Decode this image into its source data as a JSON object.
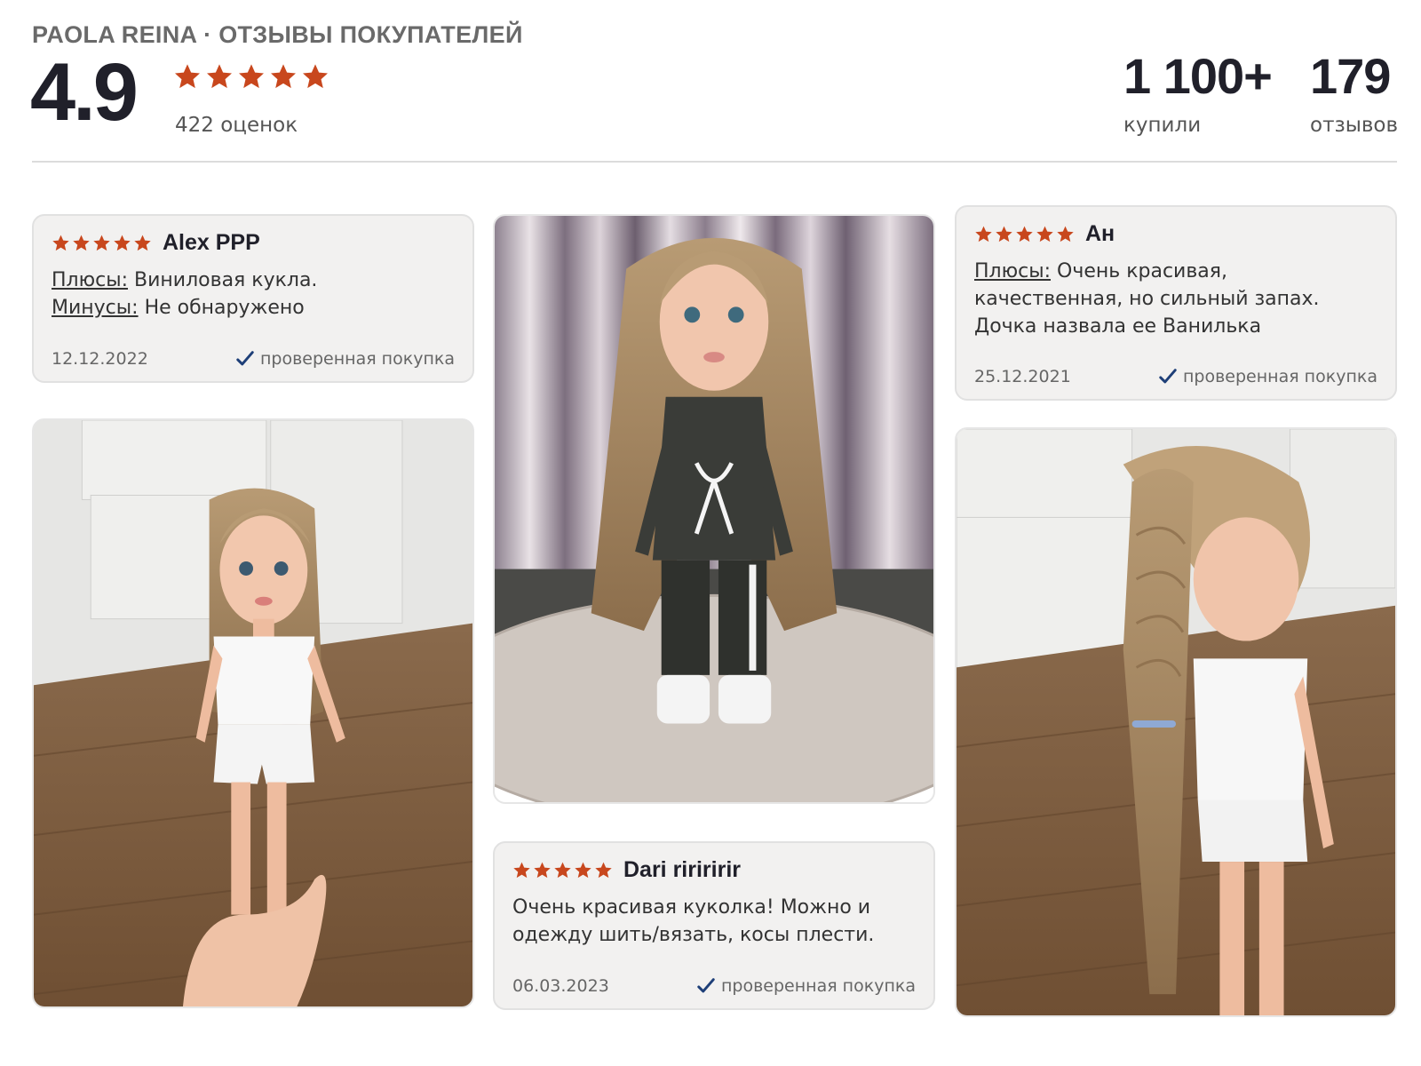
{
  "header": {
    "brand_title": "PAOLA REINA · ОТЗЫВЫ ПОКУПАТЕЛЕЙ",
    "rating": "4.9",
    "stars": 5,
    "ratings_count": "422 оценок",
    "bought_value": "1 100+",
    "bought_label": "купили",
    "reviews_value": "179",
    "reviews_label": "отзывов"
  },
  "colors": {
    "star": "#c8471d",
    "check": "#1e3f78",
    "card_bg": "#f2f1f0"
  },
  "reviews": [
    {
      "author": "Alex PPP",
      "stars": 5,
      "pros_label": "Плюсы:",
      "pros": "Виниловая кукла.",
      "cons_label": "Минусы:",
      "cons": "Не обнаружено",
      "date": "12.12.2022",
      "verified": "проверенная покупка"
    },
    {
      "author": "Dari ririririr",
      "stars": 5,
      "text_line1": "Очень красивая куколка! Можно и",
      "text_line2": "одежду шить/вязать, косы плести.",
      "date": "06.03.2023",
      "verified": "проверенная покупка"
    },
    {
      "author": "Ан",
      "stars": 5,
      "pros_label": "Плюсы:",
      "pros_line1": "Очень красивая,",
      "pros_line2": "качественная, но сильный запах.",
      "pros_line3": "Дочка назвала ее Ванилька",
      "date": "25.12.2021",
      "verified": "проверенная покупка"
    }
  ],
  "photos": [
    {
      "subject": "doll-white-pajamas-photo"
    },
    {
      "subject": "doll-long-hair-denim-photo"
    },
    {
      "subject": "doll-braid-side-photo"
    }
  ]
}
